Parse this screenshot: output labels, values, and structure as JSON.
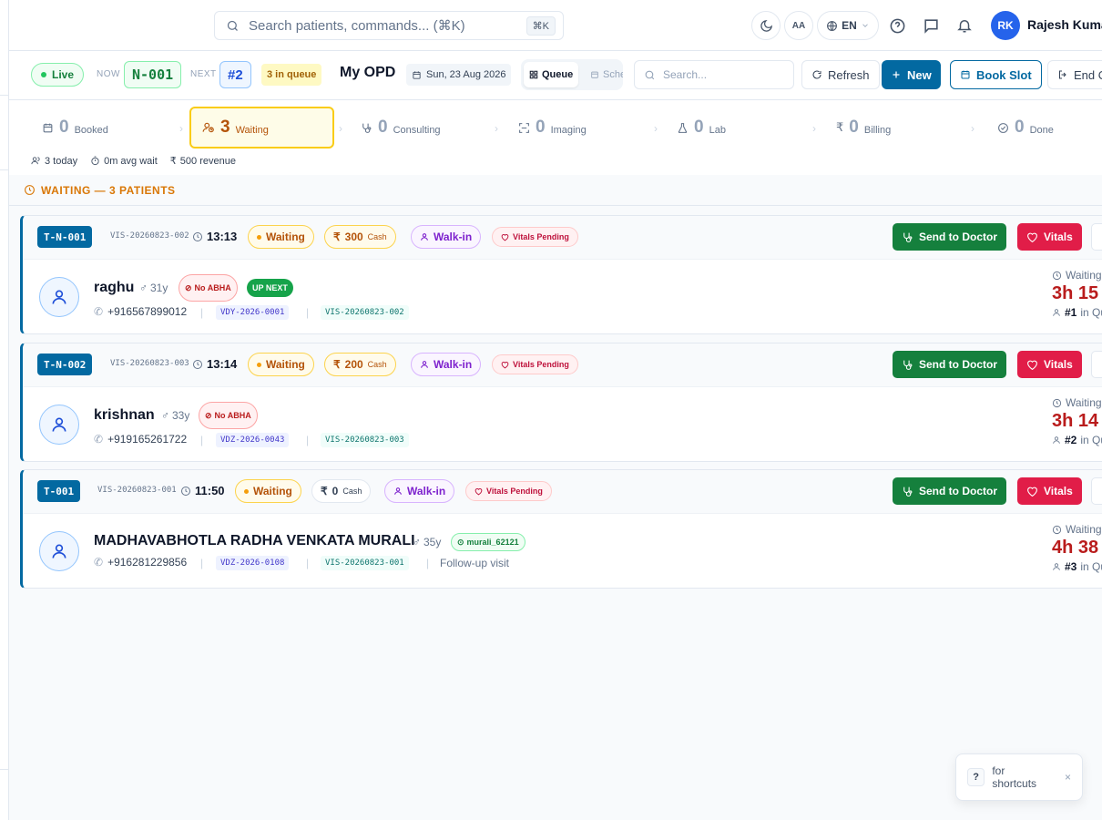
{
  "topbar": {
    "search_placeholder": "Search patients, commands... (⌘K)",
    "search_shortcut": "⌘K",
    "font_size_label": "AA",
    "language": "EN",
    "user_initials": "RK",
    "user_name": "Rajesh Kumar"
  },
  "toolbar": {
    "live_label": "Live",
    "now_label": "NOW",
    "now_token": "N-001",
    "next_label": "NEXT",
    "next_token": "#2",
    "queue_count": "3 in queue",
    "title": "My OPD",
    "date": "Sun, 23 Aug 2026",
    "view_queue": "Queue",
    "view_schedule": "Sche",
    "search_placeholder": "Search...",
    "refresh_label": "Refresh",
    "new_label": "New",
    "book_slot_label": "Book Slot",
    "end_label": "End O"
  },
  "stages": [
    {
      "count": "0",
      "label": "Booked",
      "icon": "calendar-icon"
    },
    {
      "count": "3",
      "label": "Waiting",
      "icon": "user-clock-icon"
    },
    {
      "count": "0",
      "label": "Consulting",
      "icon": "stethoscope-icon"
    },
    {
      "count": "0",
      "label": "Imaging",
      "icon": "scan-icon"
    },
    {
      "count": "0",
      "label": "Lab",
      "icon": "flask-icon"
    },
    {
      "count": "0",
      "label": "Billing",
      "icon": "rupee-icon"
    },
    {
      "count": "0",
      "label": "Done",
      "icon": "check-circle-icon"
    }
  ],
  "stats": {
    "today": "3 today",
    "avg_wait": "0m avg wait",
    "revenue": "500 revenue"
  },
  "section_header": "WAITING — 3 PATIENTS",
  "patients": [
    {
      "token": "T-N-001",
      "visit_code": "VIS-20260823-002",
      "time": "13:13",
      "status": "Waiting",
      "amount": "300",
      "pay_mode": "Cash",
      "visit_type": "Walk-in",
      "vitals": "Vitals Pending",
      "send_label": "Send to Doctor",
      "vitals_label": "Vitals",
      "name": "raghu",
      "age": "31y",
      "abha": "No ABHA",
      "up_next": "UP NEXT",
      "phone": "+916567899012",
      "patient_id": "VDY-2026-0001",
      "visit_id": "VIS-20260823-002",
      "note": "",
      "waiting_label": "Waiting",
      "wait_time": "3h 15",
      "queue_pos": "#1",
      "queue_suffix": "in Qu"
    },
    {
      "token": "T-N-002",
      "visit_code": "VIS-20260823-003",
      "time": "13:14",
      "status": "Waiting",
      "amount": "200",
      "pay_mode": "Cash",
      "visit_type": "Walk-in",
      "vitals": "Vitals Pending",
      "send_label": "Send to Doctor",
      "vitals_label": "Vitals",
      "name": "krishnan",
      "age": "33y",
      "abha": "No ABHA",
      "up_next": "",
      "phone": "+919165261722",
      "patient_id": "VDZ-2026-0043",
      "visit_id": "VIS-20260823-003",
      "note": "",
      "waiting_label": "Waiting",
      "wait_time": "3h 14",
      "queue_pos": "#2",
      "queue_suffix": "in Qu"
    },
    {
      "token": "T-001",
      "visit_code": "VIS-20260823-001",
      "time": "11:50",
      "status": "Waiting",
      "amount": "0",
      "pay_mode": "Cash",
      "visit_type": "Walk-in",
      "vitals": "Vitals Pending",
      "send_label": "Send to Doctor",
      "vitals_label": "Vitals",
      "name": "MADHAVABHOTLA RADHA VENKATA MURALI",
      "age": "35y",
      "abha": "murali_62121",
      "up_next": "",
      "phone": "+916281229856",
      "patient_id": "VDZ-2026-0108",
      "visit_id": "VIS-20260823-001",
      "note": "Follow-up visit",
      "waiting_label": "Waiting",
      "wait_time": "4h 38",
      "queue_pos": "#3",
      "queue_suffix": "in Qu"
    }
  ],
  "shortcut_hint": {
    "key": "?",
    "label": "for shortcuts",
    "close": "×"
  },
  "colors": {
    "primary": "#0369a1",
    "success": "#15803d",
    "danger": "#e11d48",
    "warning": "#d97706"
  }
}
